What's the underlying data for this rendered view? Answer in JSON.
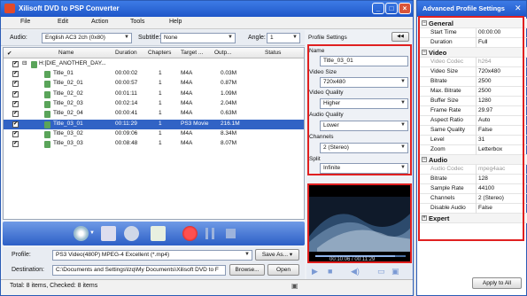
{
  "main": {
    "title": "Xilisoft DVD to PSP Converter",
    "menu": [
      "File",
      "Edit",
      "Action",
      "Tools",
      "Help"
    ],
    "audio_label": "Audio:",
    "audio_value": "English AC3 2ch (0x80)",
    "subtitle_label": "Subtitle:",
    "subtitle_value": "None",
    "angle_label": "Angle:",
    "angle_value": "1",
    "columns": [
      "Name",
      "Duration",
      "Chapters",
      "Target ...",
      "Outp...",
      "Status"
    ],
    "root": "H:[DIE_ANOTHER_DAY...",
    "rows": [
      {
        "name": "Title_01",
        "duration": "00:00:02",
        "chapters": "1",
        "target": "M4A",
        "output": "0.03M",
        "selected": false
      },
      {
        "name": "Title_02_01",
        "duration": "00:00:57",
        "chapters": "1",
        "target": "M4A",
        "output": "0.87M",
        "selected": false
      },
      {
        "name": "Title_02_02",
        "duration": "00:01:11",
        "chapters": "1",
        "target": "M4A",
        "output": "1.09M",
        "selected": false
      },
      {
        "name": "Title_02_03",
        "duration": "00:02:14",
        "chapters": "1",
        "target": "M4A",
        "output": "2.04M",
        "selected": false
      },
      {
        "name": "Title_02_04",
        "duration": "00:00:41",
        "chapters": "1",
        "target": "M4A",
        "output": "0.63M",
        "selected": false
      },
      {
        "name": "Title_03_01",
        "duration": "00:11:29",
        "chapters": "1",
        "target": "PS3 Movie",
        "output": "216.1M",
        "selected": true
      },
      {
        "name": "Title_03_02",
        "duration": "00:09:06",
        "chapters": "1",
        "target": "M4A",
        "output": "8.34M",
        "selected": false
      },
      {
        "name": "Title_03_03",
        "duration": "00:08:48",
        "chapters": "1",
        "target": "M4A",
        "output": "8.07M",
        "selected": false
      }
    ],
    "profile_label": "Profile:",
    "profile_value": "PS3 Video(480P) MPEG-4 Excellent  (*.mp4)",
    "save_as": "Save As...",
    "destination_label": "Destination:",
    "destination_value": "C:\\Documents and Settings\\lzq\\My Documents\\Xilisoft DVD to F",
    "browse": "Browse...",
    "open": "Open",
    "status": "Total: 8 items, Checked: 8 items",
    "profile_settings": {
      "header": "Profile Settings",
      "toggle": "◀◀",
      "name_label": "Name",
      "name_value": "Title_03_01",
      "video_size_label": "Video Size",
      "video_size_value": "720x480",
      "video_quality_label": "Video Quality",
      "video_quality_value": "Higher",
      "audio_quality_label": "Audio Quality",
      "audio_quality_value": "Lower",
      "channels_label": "Channels",
      "channels_value": "2 (Stereo)",
      "split_label": "Split",
      "split_value": "Infinite"
    },
    "time_display": "00:10:06 / 00:11:29"
  },
  "advanced": {
    "title": "Advanced Profile Settings",
    "general_label": "General",
    "rows_general": [
      {
        "k": "Start Time",
        "v": "00:00:00",
        "dis": false
      },
      {
        "k": "Duration",
        "v": "Full",
        "dis": false
      }
    ],
    "video_label": "Video",
    "rows_video": [
      {
        "k": "Video Codec",
        "v": "h264",
        "dis": true
      },
      {
        "k": "Video Size",
        "v": "720x480",
        "dis": false
      },
      {
        "k": "Bitrate",
        "v": "2500",
        "dis": false
      },
      {
        "k": "Max. Bitrate",
        "v": "2500",
        "dis": false
      },
      {
        "k": "Buffer Size",
        "v": "1280",
        "dis": false
      },
      {
        "k": "Frame Rate",
        "v": "29.97",
        "dis": false
      },
      {
        "k": "Aspect Ratio",
        "v": "Auto",
        "dis": false
      },
      {
        "k": "Same Quality",
        "v": "False",
        "dis": false
      },
      {
        "k": "Level",
        "v": "31",
        "dis": false
      },
      {
        "k": "Zoom",
        "v": "Letterbox",
        "dis": false
      }
    ],
    "audio_label": "Audio",
    "rows_audio": [
      {
        "k": "Audio Codec",
        "v": "mpeg4aac",
        "dis": true
      },
      {
        "k": "Bitrate",
        "v": "128",
        "dis": false
      },
      {
        "k": "Sample Rate",
        "v": "44100",
        "dis": false
      },
      {
        "k": "Channels",
        "v": "2 (Stereo)",
        "dis": false
      },
      {
        "k": "Disable Audio",
        "v": "False",
        "dis": false
      }
    ],
    "expert_label": "Expert",
    "apply_all": "Apply to All"
  }
}
